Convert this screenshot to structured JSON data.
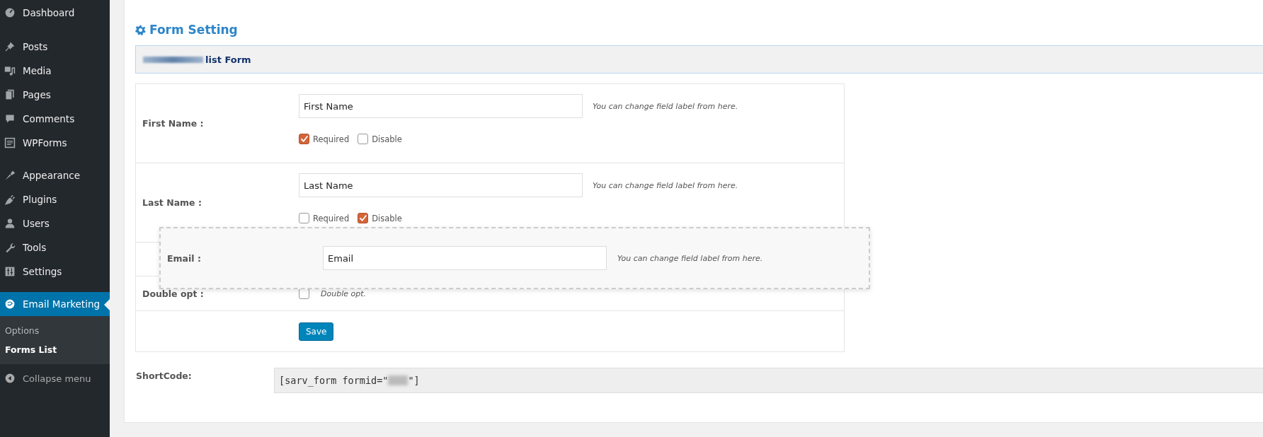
{
  "sidebar": {
    "menu_groups": [
      [
        {
          "label": "Dashboard",
          "selected": false
        }
      ],
      [
        {
          "label": "Posts",
          "selected": false
        },
        {
          "label": "Media",
          "selected": false
        },
        {
          "label": "Pages",
          "selected": false
        },
        {
          "label": "Comments",
          "selected": false
        },
        {
          "label": "WPForms",
          "selected": false
        }
      ],
      [
        {
          "label": "Appearance",
          "selected": false
        },
        {
          "label": "Plugins",
          "selected": false
        },
        {
          "label": "Users",
          "selected": false
        },
        {
          "label": "Tools",
          "selected": false
        },
        {
          "label": "Settings",
          "selected": false
        }
      ],
      [
        {
          "label": "Email Marketing",
          "selected": true
        }
      ]
    ],
    "submenu": [
      {
        "label": "Options",
        "selected": false
      },
      {
        "label": "Forms List",
        "selected": true
      }
    ],
    "collapse": "Collapse menu"
  },
  "heading": "Form Setting",
  "form_header": "list Form",
  "fields": [
    {
      "label": "First Name :",
      "value": "First Name",
      "hint": "You can change field label from here.",
      "options": [
        {
          "label": "Required",
          "checked": true
        },
        {
          "label": "Disable",
          "checked": false
        }
      ]
    },
    {
      "label": "Last Name :",
      "value": "Last Name",
      "hint": "You can change field label from here.",
      "options": [
        {
          "label": "Required",
          "checked": false
        },
        {
          "label": "Disable",
          "checked": true
        }
      ]
    }
  ],
  "dragged_field": {
    "label": "Email :",
    "value": "Email",
    "hint": "You can change field label from here."
  },
  "double_opt": {
    "label": "Double opt :",
    "checked": false,
    "text": "Double opt."
  },
  "save_button": "Save",
  "shortcode": {
    "label": "ShortCode:",
    "value": "[sarv_form formid=\"",
    "tail": "\"]"
  }
}
